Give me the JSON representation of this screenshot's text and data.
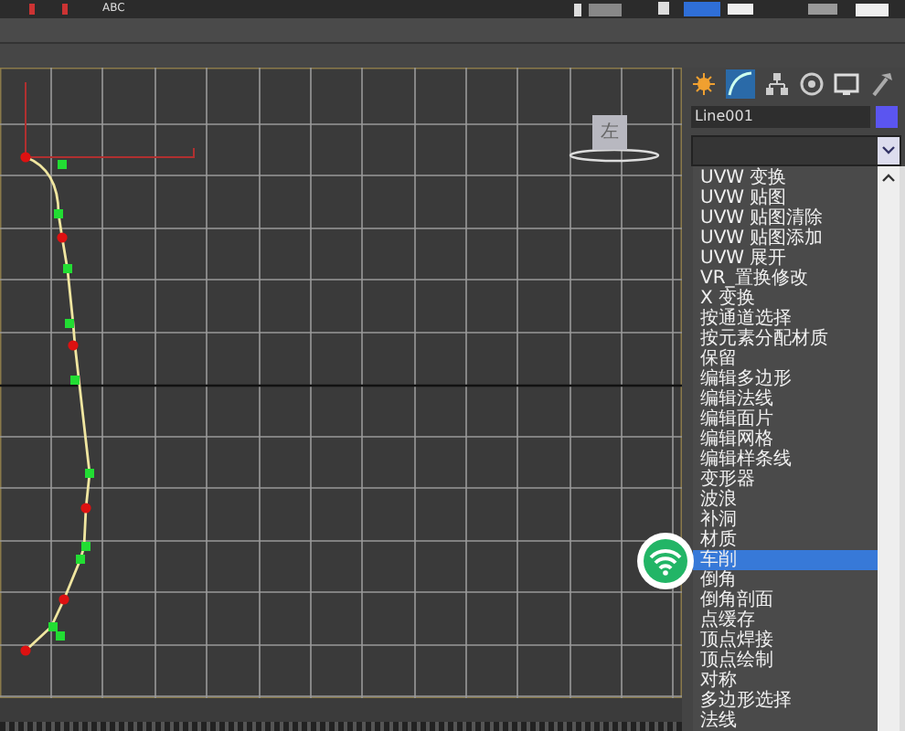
{
  "toolbar": {
    "label": "ABC"
  },
  "viewport": {
    "view_cube_label": "左"
  },
  "command_panel": {
    "object_name": "Line001",
    "modifier_list": {
      "items": [
        {
          "label": "UVW 变换",
          "selected": false
        },
        {
          "label": "UVW 贴图",
          "selected": false
        },
        {
          "label": "UVW 贴图清除",
          "selected": false
        },
        {
          "label": "UVW 贴图添加",
          "selected": false
        },
        {
          "label": "UVW 展开",
          "selected": false
        },
        {
          "label": "VR_置换修改",
          "selected": false
        },
        {
          "label": "X 变换",
          "selected": false
        },
        {
          "label": "按通道选择",
          "selected": false
        },
        {
          "label": "按元素分配材质",
          "selected": false
        },
        {
          "label": "保留",
          "selected": false
        },
        {
          "label": "编辑多边形",
          "selected": false
        },
        {
          "label": "编辑法线",
          "selected": false
        },
        {
          "label": "编辑面片",
          "selected": false
        },
        {
          "label": "编辑网格",
          "selected": false
        },
        {
          "label": "编辑样条线",
          "selected": false
        },
        {
          "label": "变形器",
          "selected": false
        },
        {
          "label": "波浪",
          "selected": false
        },
        {
          "label": "补洞",
          "selected": false
        },
        {
          "label": "材质",
          "selected": false
        },
        {
          "label": "车削",
          "selected": true
        },
        {
          "label": "倒角",
          "selected": false
        },
        {
          "label": "倒角剖面",
          "selected": false
        },
        {
          "label": "点缓存",
          "selected": false
        },
        {
          "label": "顶点焊接",
          "selected": false
        },
        {
          "label": "顶点绘制",
          "selected": false
        },
        {
          "label": "对称",
          "selected": false
        },
        {
          "label": "多边形选择",
          "selected": false
        },
        {
          "label": "法线",
          "selected": false
        }
      ]
    }
  }
}
